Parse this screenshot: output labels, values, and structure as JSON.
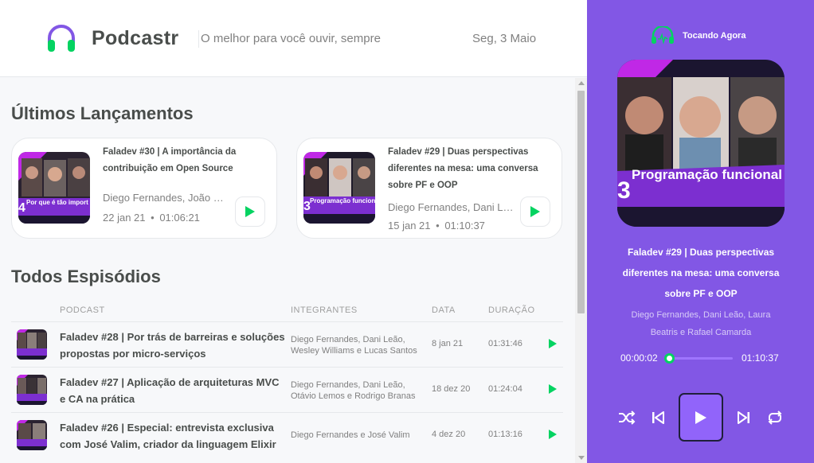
{
  "header": {
    "app_name": "Podcastr",
    "tagline": "O melhor para você ouvir, sempre",
    "date": "Seg, 3 Maio",
    "icon": "headphones-icon"
  },
  "latest": {
    "title": "Últimos Lançamentos",
    "items": [
      {
        "title": "Faladev #30 | A importância da contribuição em Open Source",
        "members": "Diego Fernandes, João Pedro Schmitz",
        "date": "22 jan 21",
        "duration": "01:06:21",
        "thumb_text": "Por que é tão importante contribuir em Open Source",
        "thumb_number": "4"
      },
      {
        "title": "Faladev #29 | Duas perspectivas diferentes na mesa: uma conversa sobre PF e OOP",
        "members": "Diego Fernandes, Dani Leão, Laura Beatris e Rafael Camarda",
        "date": "15 jan 21",
        "duration": "01:10:37",
        "thumb_text": "Programação funcional para devs orientados a objetos",
        "thumb_number": "3"
      }
    ]
  },
  "all": {
    "title": "Todos Espisódios",
    "columns": [
      "PODCAST",
      "INTEGRANTES",
      "DATA",
      "DURAÇÃO"
    ],
    "rows": [
      {
        "title": "Faladev #28 | Por trás de barreiras e soluções propostas por micro-serviços",
        "members": "Diego Fernandes, Dani Leão, Wesley Williams e Lucas Santos",
        "date": "8 jan 21",
        "duration": "01:31:46"
      },
      {
        "title": "Faladev #27 | Aplicação de arquiteturas MVC e CA na prática",
        "members": "Diego Fernandes, Dani Leão, Otávio Lemos e Rodrigo Branas",
        "date": "18 dez 20",
        "duration": "01:24:04"
      },
      {
        "title": "Faladev #26 | Especial: entrevista exclusiva com José Valim, criador da linguagem Elixir",
        "members": "Diego Fernandes e José Valim",
        "date": "4 dez 20",
        "duration": "01:13:16"
      }
    ]
  },
  "player": {
    "header": "Tocando Agora",
    "title": "Faladev #29 | Duas perspectivas diferentes na mesa: uma conversa sobre PF e OOP",
    "members": "Diego Fernandes, Dani Leão, Laura Beatris e Rafael Camarda",
    "current_time": "00:00:02",
    "total_time": "01:10:37",
    "progress": 0.02,
    "cover_text": "Programação funcional para devs orientados a objetos",
    "cover_number": "3"
  },
  "colors": {
    "purple": "#8257e5",
    "green": "#04d361",
    "text": "#494d4b",
    "muted": "#808080"
  }
}
